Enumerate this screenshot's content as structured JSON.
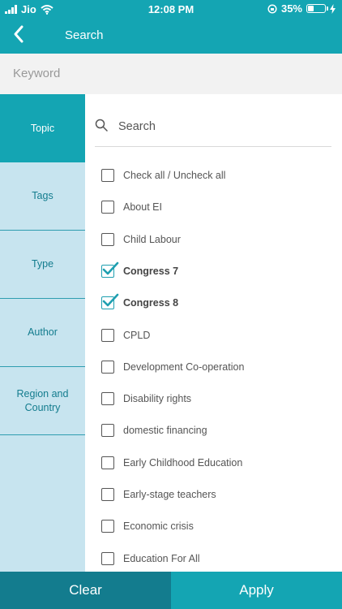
{
  "status": {
    "carrier": "Jio",
    "time": "12:08 PM",
    "battery_percent": "35%",
    "battery_level": 0.35
  },
  "header": {
    "title": "Search"
  },
  "keyword": {
    "placeholder": "Keyword"
  },
  "sidebar": {
    "items": [
      {
        "label": "Topic",
        "active": true
      },
      {
        "label": "Tags",
        "active": false
      },
      {
        "label": "Type",
        "active": false
      },
      {
        "label": "Author",
        "active": false
      },
      {
        "label": "Region and\nCountry",
        "active": false
      }
    ]
  },
  "list": {
    "search_placeholder": "Search",
    "options": [
      {
        "label": "Check all / Uncheck all",
        "checked": false
      },
      {
        "label": "About EI",
        "checked": false
      },
      {
        "label": "Child Labour",
        "checked": false
      },
      {
        "label": "Congress 7",
        "checked": true
      },
      {
        "label": "Congress 8",
        "checked": true
      },
      {
        "label": "CPLD",
        "checked": false
      },
      {
        "label": "Development Co-operation",
        "checked": false
      },
      {
        "label": "Disability rights",
        "checked": false
      },
      {
        "label": "domestic financing",
        "checked": false
      },
      {
        "label": "Early Childhood Education",
        "checked": false
      },
      {
        "label": "Early-stage teachers",
        "checked": false
      },
      {
        "label": "Economic crisis",
        "checked": false
      },
      {
        "label": "Education For All",
        "checked": false
      }
    ]
  },
  "footer": {
    "clear_label": "Clear",
    "apply_label": "Apply"
  },
  "colors": {
    "primary": "#14a5b3",
    "dark": "#137c8e",
    "sidebar_bg": "#c7e4ef"
  }
}
